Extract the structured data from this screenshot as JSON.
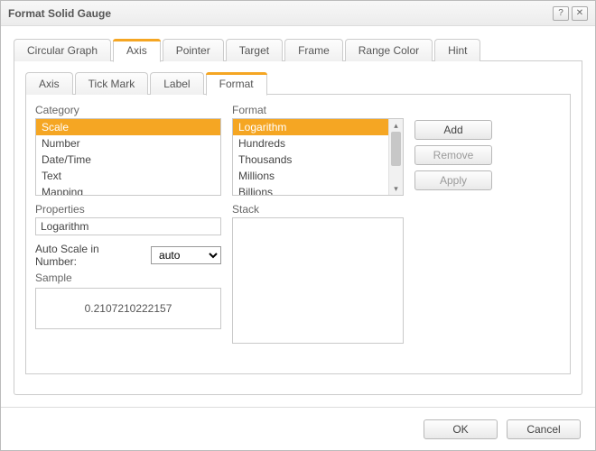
{
  "title": "Format Solid Gauge",
  "mainTabs": {
    "items": [
      {
        "label": "Circular Graph"
      },
      {
        "label": "Axis"
      },
      {
        "label": "Pointer"
      },
      {
        "label": "Target"
      },
      {
        "label": "Frame"
      },
      {
        "label": "Range Color"
      },
      {
        "label": "Hint"
      }
    ]
  },
  "subTabs": {
    "items": [
      {
        "label": "Axis"
      },
      {
        "label": "Tick Mark"
      },
      {
        "label": "Label"
      },
      {
        "label": "Format"
      }
    ]
  },
  "labels": {
    "category": "Category",
    "format": "Format",
    "stack": "Stack",
    "properties": "Properties",
    "autoScale": "Auto Scale in Number:",
    "sample": "Sample"
  },
  "category": {
    "items": [
      "Scale",
      "Number",
      "Date/Time",
      "Text",
      "Mapping"
    ],
    "selected": "Scale"
  },
  "format": {
    "items": [
      "Logarithm",
      "Hundreds",
      "Thousands",
      "Millions",
      "Billions"
    ],
    "selected": "Logarithm"
  },
  "properties": {
    "value": "Logarithm"
  },
  "autoScale": {
    "value": "auto",
    "options": [
      "auto"
    ]
  },
  "sample": {
    "value": "0.2107210222157"
  },
  "buttons": {
    "add": "Add",
    "remove": "Remove",
    "apply": "Apply",
    "ok": "OK",
    "cancel": "Cancel"
  }
}
